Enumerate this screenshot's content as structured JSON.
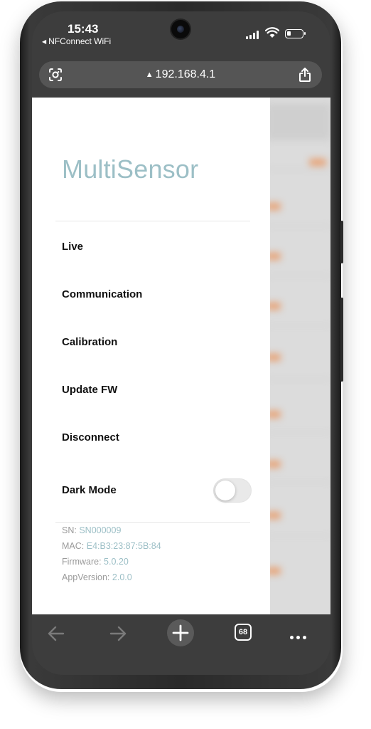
{
  "status_bar": {
    "time": "15:43",
    "carrier": "NFConnect WiFi",
    "back_arrow_icon": "small-left-triangle"
  },
  "browser": {
    "url": "192.168.4.1",
    "url_warning_icon": "warning-triangle",
    "scan_icon": "lens-scan",
    "share_icon": "share",
    "tab_count": "68"
  },
  "drawer": {
    "brand": "MultiSensor",
    "brand_color": "#9cbfc6",
    "nav": [
      {
        "label": "Live"
      },
      {
        "label": "Communication"
      },
      {
        "label": "Calibration"
      },
      {
        "label": "Update FW"
      },
      {
        "label": "Disconnect"
      }
    ],
    "dark_mode": {
      "label": "Dark Mode",
      "enabled": false
    },
    "device_info": {
      "sn_label": "SN:",
      "sn_value": "SN000009",
      "mac_label": "MAC:",
      "mac_value": "E4:B3:23:87:5B:84",
      "firmware_label": "Firmware:",
      "firmware_value": "5.0.20",
      "app_version_label": "AppVersion:",
      "app_version_value": "2.0.0"
    }
  },
  "colors": {
    "accent": "#9cbfc6",
    "background_highlight": "#e8a071"
  }
}
